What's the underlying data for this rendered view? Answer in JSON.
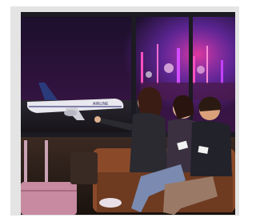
{
  "image": {
    "description_label": "photo",
    "plane_livery": "AIRLINE",
    "colors": {
      "frame": "#e4e4e4",
      "night_sky": "#1b0f2b",
      "neon_pink": "#ff3fb0",
      "neon_purple": "#9a3cff",
      "window_frame": "#1c1a22"
    }
  }
}
